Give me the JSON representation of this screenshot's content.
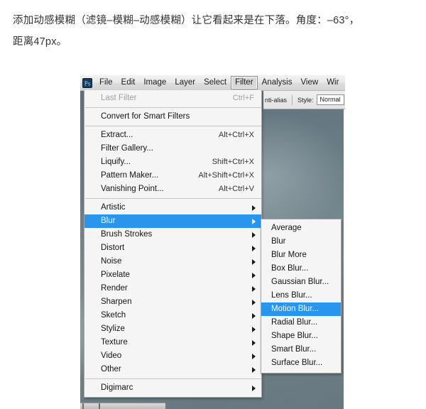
{
  "article": {
    "line1": "添加动感模糊（滤镜–模糊–动感模糊）让它看起来是在下落。角度：–63°，",
    "line2": "距离47px。"
  },
  "screenshot": {
    "app": "Adobe Photoshop",
    "menubar": {
      "app_icon": "photoshop-app-icon",
      "items": [
        {
          "label": "File",
          "active": false
        },
        {
          "label": "Edit",
          "active": false
        },
        {
          "label": "Image",
          "active": false
        },
        {
          "label": "Layer",
          "active": false
        },
        {
          "label": "Select",
          "active": false
        },
        {
          "label": "Filter",
          "active": true
        },
        {
          "label": "Analysis",
          "active": false
        },
        {
          "label": "View",
          "active": false
        },
        {
          "label": "Wir",
          "active": false
        }
      ]
    },
    "options_bar": {
      "antialias_label": "nti-alias",
      "style_label": "Style:",
      "style_value": "Normal"
    },
    "filter_menu": {
      "groups": [
        {
          "items": [
            {
              "label": "Last Filter",
              "accel": "Ctrl+F",
              "disabled": true,
              "submenu": false,
              "selected": false
            }
          ]
        },
        {
          "items": [
            {
              "label": "Convert for Smart Filters",
              "accel": "",
              "disabled": false,
              "submenu": false,
              "selected": false
            }
          ]
        },
        {
          "items": [
            {
              "label": "Extract...",
              "accel": "Alt+Ctrl+X",
              "disabled": false,
              "submenu": false,
              "selected": false
            },
            {
              "label": "Filter Gallery...",
              "accel": "",
              "disabled": false,
              "submenu": false,
              "selected": false
            },
            {
              "label": "Liquify...",
              "accel": "Shift+Ctrl+X",
              "disabled": false,
              "submenu": false,
              "selected": false
            },
            {
              "label": "Pattern Maker...",
              "accel": "Alt+Shift+Ctrl+X",
              "disabled": false,
              "submenu": false,
              "selected": false
            },
            {
              "label": "Vanishing Point...",
              "accel": "Alt+Ctrl+V",
              "disabled": false,
              "submenu": false,
              "selected": false
            }
          ]
        },
        {
          "items": [
            {
              "label": "Artistic",
              "accel": "",
              "disabled": false,
              "submenu": true,
              "selected": false
            },
            {
              "label": "Blur",
              "accel": "",
              "disabled": false,
              "submenu": true,
              "selected": true
            },
            {
              "label": "Brush Strokes",
              "accel": "",
              "disabled": false,
              "submenu": true,
              "selected": false
            },
            {
              "label": "Distort",
              "accel": "",
              "disabled": false,
              "submenu": true,
              "selected": false
            },
            {
              "label": "Noise",
              "accel": "",
              "disabled": false,
              "submenu": true,
              "selected": false
            },
            {
              "label": "Pixelate",
              "accel": "",
              "disabled": false,
              "submenu": true,
              "selected": false
            },
            {
              "label": "Render",
              "accel": "",
              "disabled": false,
              "submenu": true,
              "selected": false
            },
            {
              "label": "Sharpen",
              "accel": "",
              "disabled": false,
              "submenu": true,
              "selected": false
            },
            {
              "label": "Sketch",
              "accel": "",
              "disabled": false,
              "submenu": true,
              "selected": false
            },
            {
              "label": "Stylize",
              "accel": "",
              "disabled": false,
              "submenu": true,
              "selected": false
            },
            {
              "label": "Texture",
              "accel": "",
              "disabled": false,
              "submenu": true,
              "selected": false
            },
            {
              "label": "Video",
              "accel": "",
              "disabled": false,
              "submenu": true,
              "selected": false
            },
            {
              "label": "Other",
              "accel": "",
              "disabled": false,
              "submenu": true,
              "selected": false
            }
          ]
        },
        {
          "items": [
            {
              "label": "Digimarc",
              "accel": "",
              "disabled": false,
              "submenu": true,
              "selected": false
            }
          ]
        }
      ]
    },
    "blur_submenu": {
      "items": [
        {
          "label": "Average",
          "selected": false
        },
        {
          "label": "Blur",
          "selected": false
        },
        {
          "label": "Blur More",
          "selected": false
        },
        {
          "label": "Box Blur...",
          "selected": false
        },
        {
          "label": "Gaussian Blur...",
          "selected": false
        },
        {
          "label": "Lens Blur...",
          "selected": false
        },
        {
          "label": "Motion Blur...",
          "selected": true
        },
        {
          "label": "Radial Blur...",
          "selected": false
        },
        {
          "label": "Shape Blur...",
          "selected": false
        },
        {
          "label": "Smart Blur...",
          "selected": false
        },
        {
          "label": "Surface Blur...",
          "selected": false
        }
      ]
    },
    "colors": {
      "highlight": "#2a95ec",
      "highlight_text": "#ffffff",
      "menu_bg": "#f5f5f5",
      "menu_border": "#a6a6a6",
      "disabled_text": "#a0a0a0",
      "canvas": "#6e7f87"
    }
  }
}
